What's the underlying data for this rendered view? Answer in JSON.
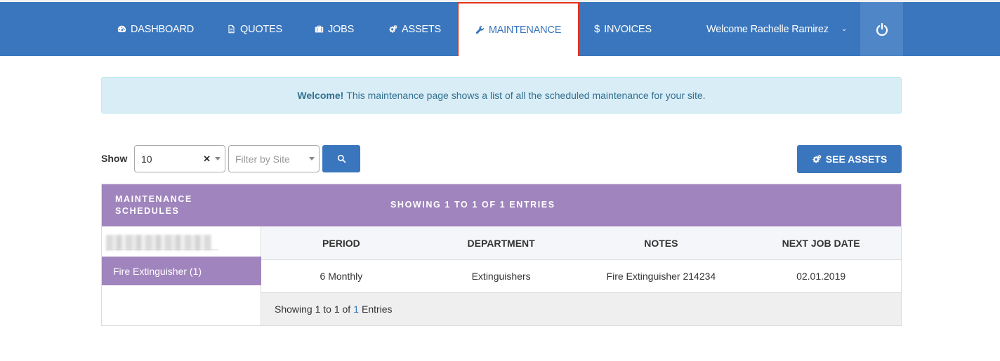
{
  "nav": {
    "items": [
      {
        "label": "DASHBOARD",
        "icon": "dashboard-icon"
      },
      {
        "label": "QUOTES",
        "icon": "document-icon"
      },
      {
        "label": "JOBS",
        "icon": "briefcase-icon"
      },
      {
        "label": "ASSETS",
        "icon": "cogs-icon"
      },
      {
        "label": "MAINTENANCE",
        "icon": "wrench-icon"
      },
      {
        "label": "INVOICES",
        "icon": "dollar-icon"
      }
    ],
    "active": "MAINTENANCE",
    "welcome": "Welcome Rachelle Ramirez",
    "accent": "#3a76bd",
    "highlight": "#e8331c"
  },
  "alert": {
    "strong": "Welcome!",
    "text": "This maintenance page shows a list of all the scheduled maintenance for your site."
  },
  "controls": {
    "show_label": "Show",
    "page_size": "10",
    "site_placeholder": "Filter by Site",
    "see_assets_label": "SEE ASSETS"
  },
  "panel": {
    "title": "MAINTENANCE SCHEDULES",
    "showing": "SHOWING 1 TO 1 OF 1 ENTRIES",
    "purple": "#a084bd",
    "sidebar_items": [
      "Fire Extinguisher (1)"
    ],
    "columns": [
      "PERIOD",
      "DEPARTMENT",
      "NOTES",
      "NEXT JOB DATE"
    ],
    "rows": [
      [
        "6 Monthly",
        "Extinguishers",
        "Fire Extinguisher 214234",
        "02.01.2019"
      ]
    ],
    "footer": {
      "prefix": "Showing 1 to 1 of",
      "link": "1",
      "suffix": "Entries"
    }
  }
}
